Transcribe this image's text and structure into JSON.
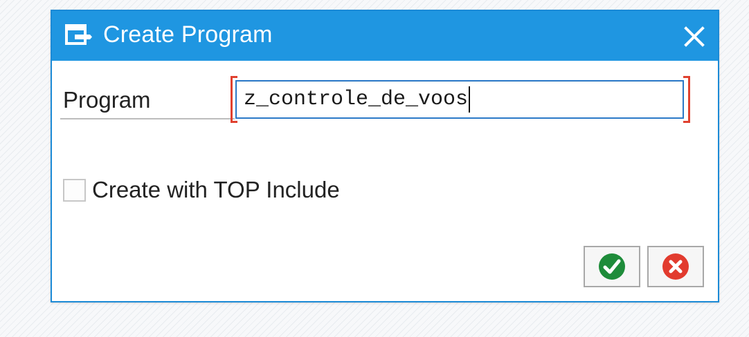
{
  "dialog": {
    "title": "Create Program",
    "title_icon": "create-object-icon",
    "close_icon": "close-icon"
  },
  "form": {
    "program_label": "Program",
    "program_value": "z_controle_de_voos",
    "checkbox_label": "Create with TOP Include",
    "checkbox_checked": false
  },
  "buttons": {
    "ok_icon": "checkmark-icon",
    "cancel_icon": "cancel-icon"
  },
  "colors": {
    "titlebar": "#1f96e1",
    "required_marker": "#e0412f",
    "ok": "#1e8c3a",
    "cancel": "#e23b2e"
  }
}
